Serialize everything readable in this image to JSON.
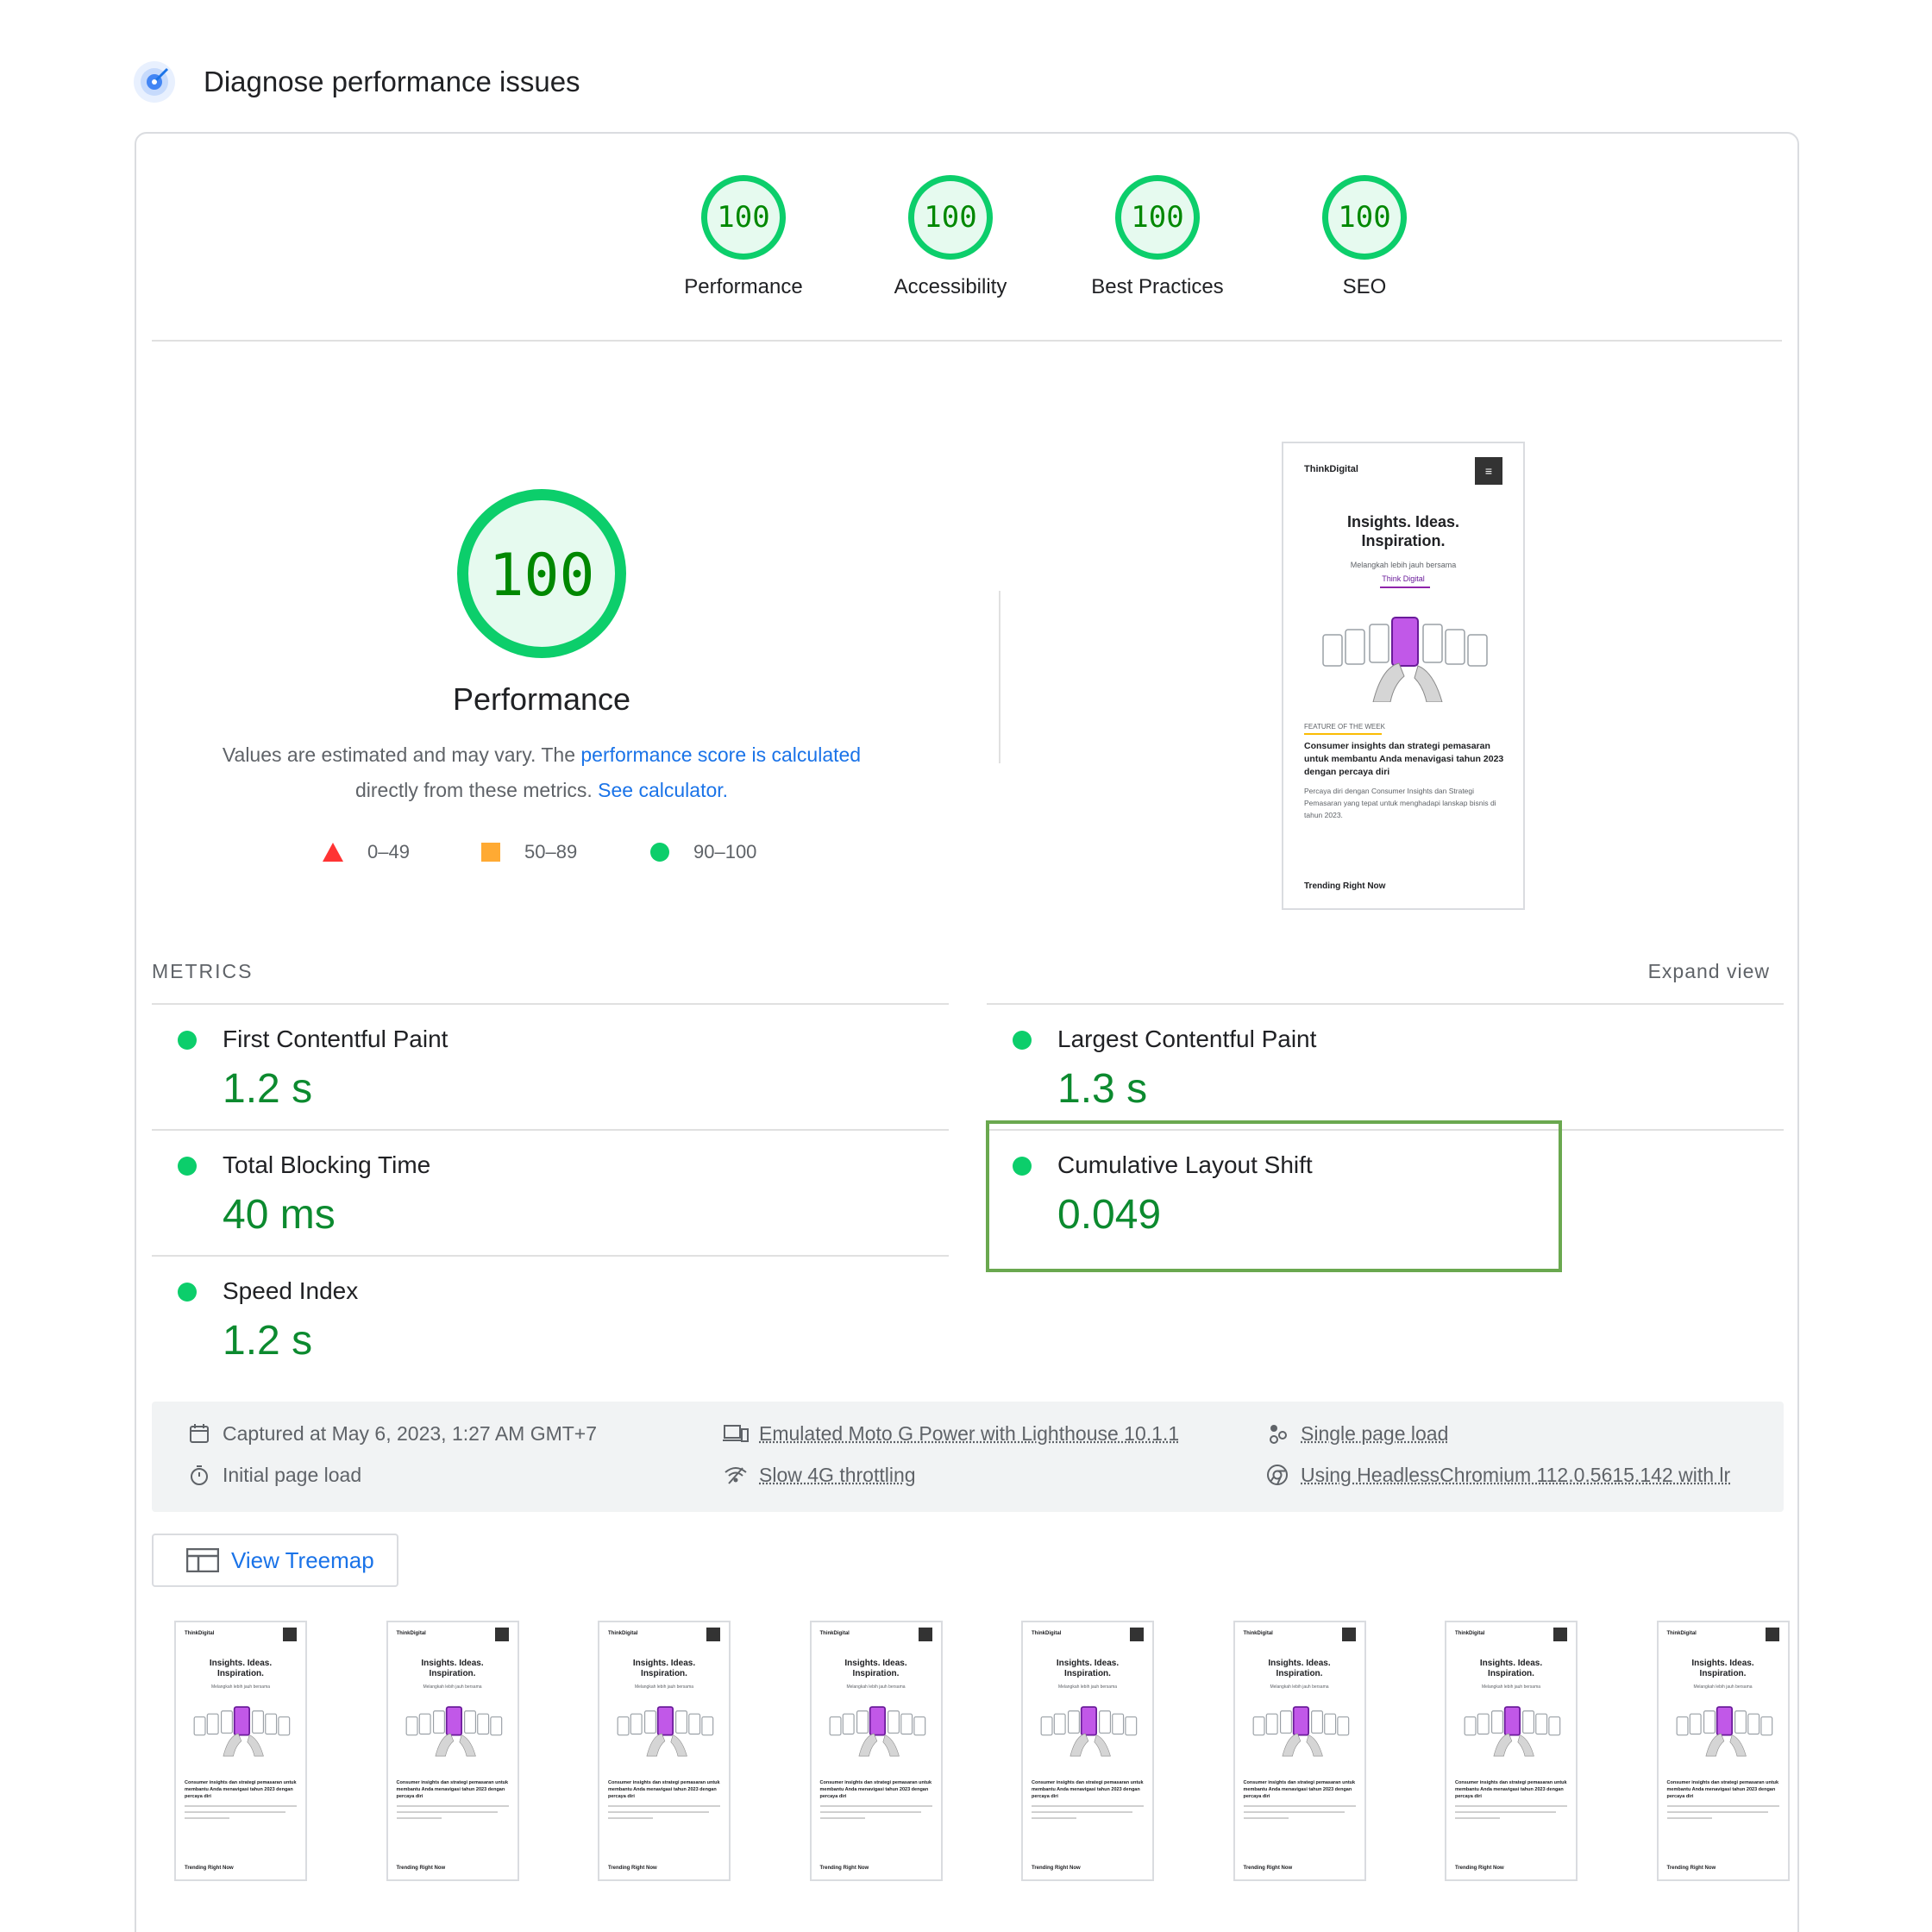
{
  "header": {
    "title": "Diagnose performance issues"
  },
  "gauges": [
    {
      "score": "100",
      "label": "Performance"
    },
    {
      "score": "100",
      "label": "Accessibility"
    },
    {
      "score": "100",
      "label": "Best Practices"
    },
    {
      "score": "100",
      "label": "SEO"
    }
  ],
  "performance": {
    "score": "100",
    "label": "Performance",
    "desc_prefix": "Values are estimated and may vary. The ",
    "desc_link1": "performance score is calculated",
    "desc_middle": "directly from these metrics. ",
    "desc_link2": "See calculator."
  },
  "legend": [
    {
      "range": "0–49",
      "shape": "triangle",
      "color": "#ff3333"
    },
    {
      "range": "50–89",
      "shape": "square",
      "color": "#ffaa33"
    },
    {
      "range": "90–100",
      "shape": "circle",
      "color": "#0cce6b"
    }
  ],
  "screenshot": {
    "brand": "ThinkDigital",
    "headline_1": "Insights. Ideas.",
    "headline_2": "Inspiration.",
    "sub": "Melangkah lebih jauh bersama",
    "sub_link": "Think Digital",
    "feature_tag": "FEATURE OF THE WEEK",
    "feature_title": "Consumer insights dan strategi pemasaran untuk membantu Anda menavigasi tahun 2023 dengan percaya diri",
    "feature_body": "Percaya diri dengan Consumer Insights dan Strategi Pemasaran yang tepat untuk menghadapi lanskap bisnis di tahun 2023.",
    "trending": "Trending Right Now"
  },
  "metrics": {
    "title": "METRICS",
    "expand": "Expand view",
    "items": [
      {
        "name": "First Contentful Paint",
        "value": "1.2 s"
      },
      {
        "name": "Largest Contentful Paint",
        "value": "1.3 s"
      },
      {
        "name": "Total Blocking Time",
        "value": "40 ms"
      },
      {
        "name": "Cumulative Layout Shift",
        "value": "0.049"
      },
      {
        "name": "Speed Index",
        "value": "1.2 s"
      }
    ]
  },
  "runtime": {
    "captured": "Captured at May 6, 2023, 1:27 AM GMT+7",
    "initial": "Initial page load",
    "device": "Emulated Moto G Power with Lighthouse 10.1.1",
    "throttling": "Slow 4G throttling",
    "single": "Single page load",
    "browser": "Using HeadlessChromium 112.0.5615.142 with lr"
  },
  "treemap": {
    "label": "View Treemap"
  },
  "filmstrip_count": 8,
  "colors": {
    "pass": "#0cce6b",
    "pass_text": "#0c8a2f",
    "link": "#1a73e8",
    "highlight": "#6aa84f"
  }
}
